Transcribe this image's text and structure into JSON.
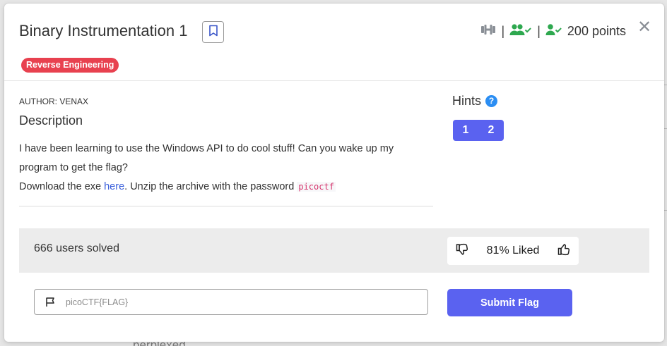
{
  "background": {
    "text": "perplexed"
  },
  "challenge": {
    "title": "Binary Instrumentation 1",
    "points": "200 points",
    "category_tag": "Reverse Engineering",
    "author": "AUTHOR: VENAX",
    "description_heading": "Description",
    "description_line1": "I have been learning to use the Windows API to do cool stuff! Can you wake up my program to get the flag?",
    "description_line2_prefix": "Download the exe ",
    "description_link": "here",
    "description_line2_middle": ". Unzip the archive with the password ",
    "password": "picoctf"
  },
  "hints": {
    "title": "Hints",
    "help_glyph": "?",
    "buttons": [
      "1",
      "2"
    ]
  },
  "stats": {
    "solved": "666 users solved",
    "liked": "81% Liked"
  },
  "submit": {
    "placeholder": "picoCTF{FLAG}",
    "button_label": "Submit Flag"
  },
  "icons": {
    "difficulty": "dumbbell-icon",
    "users": "users-check-icon",
    "user": "user-check-icon",
    "close": "close-icon",
    "bookmark": "bookmark-icon",
    "flag": "flag-icon",
    "thumbs_down": "thumbs-down-icon",
    "thumbs_up": "thumbs-up-icon"
  },
  "colors": {
    "accent": "#5a62f0",
    "tag": "#e8414f",
    "green": "#2ea84f",
    "link": "#3a5fdb",
    "code": "#d6336c"
  }
}
